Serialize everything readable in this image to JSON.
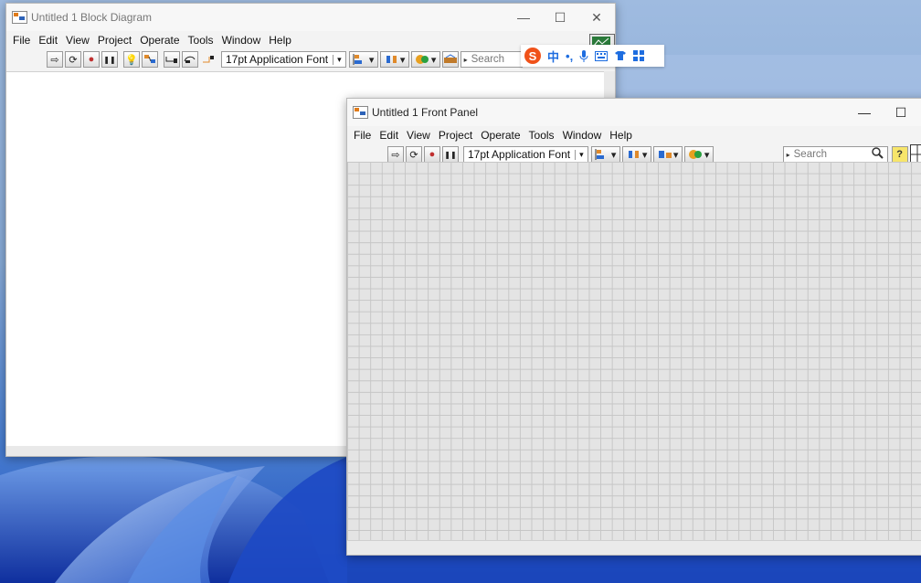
{
  "block_diagram": {
    "title": "Untitled 1 Block Diagram",
    "menu": [
      "File",
      "Edit",
      "View",
      "Project",
      "Operate",
      "Tools",
      "Window",
      "Help"
    ],
    "font_select": "17pt Application Font",
    "search_label": "Search",
    "controls": {
      "minimize": "—",
      "maximize": "☐",
      "close": "✕"
    }
  },
  "front_panel": {
    "title": "Untitled 1 Front Panel",
    "menu": [
      "File",
      "Edit",
      "View",
      "Project",
      "Operate",
      "Tools",
      "Window",
      "Help"
    ],
    "font_select": "17pt Application Font",
    "search_label": "Search",
    "controls": {
      "minimize": "—",
      "maximize": "☐"
    }
  },
  "ime_bar": {
    "logo": "S",
    "mode": "中",
    "punct": "•,",
    "voice": "🎤",
    "keyboard": "⌨",
    "skin": "👕",
    "tools": "⁘"
  },
  "icons": {
    "run_arrow": "⇨",
    "run_continuous": "⟳",
    "abort": "●",
    "pause": "❚❚",
    "highlight": "💡",
    "dropdown": "▾",
    "search_magnifier": "🔍",
    "help": "?"
  }
}
